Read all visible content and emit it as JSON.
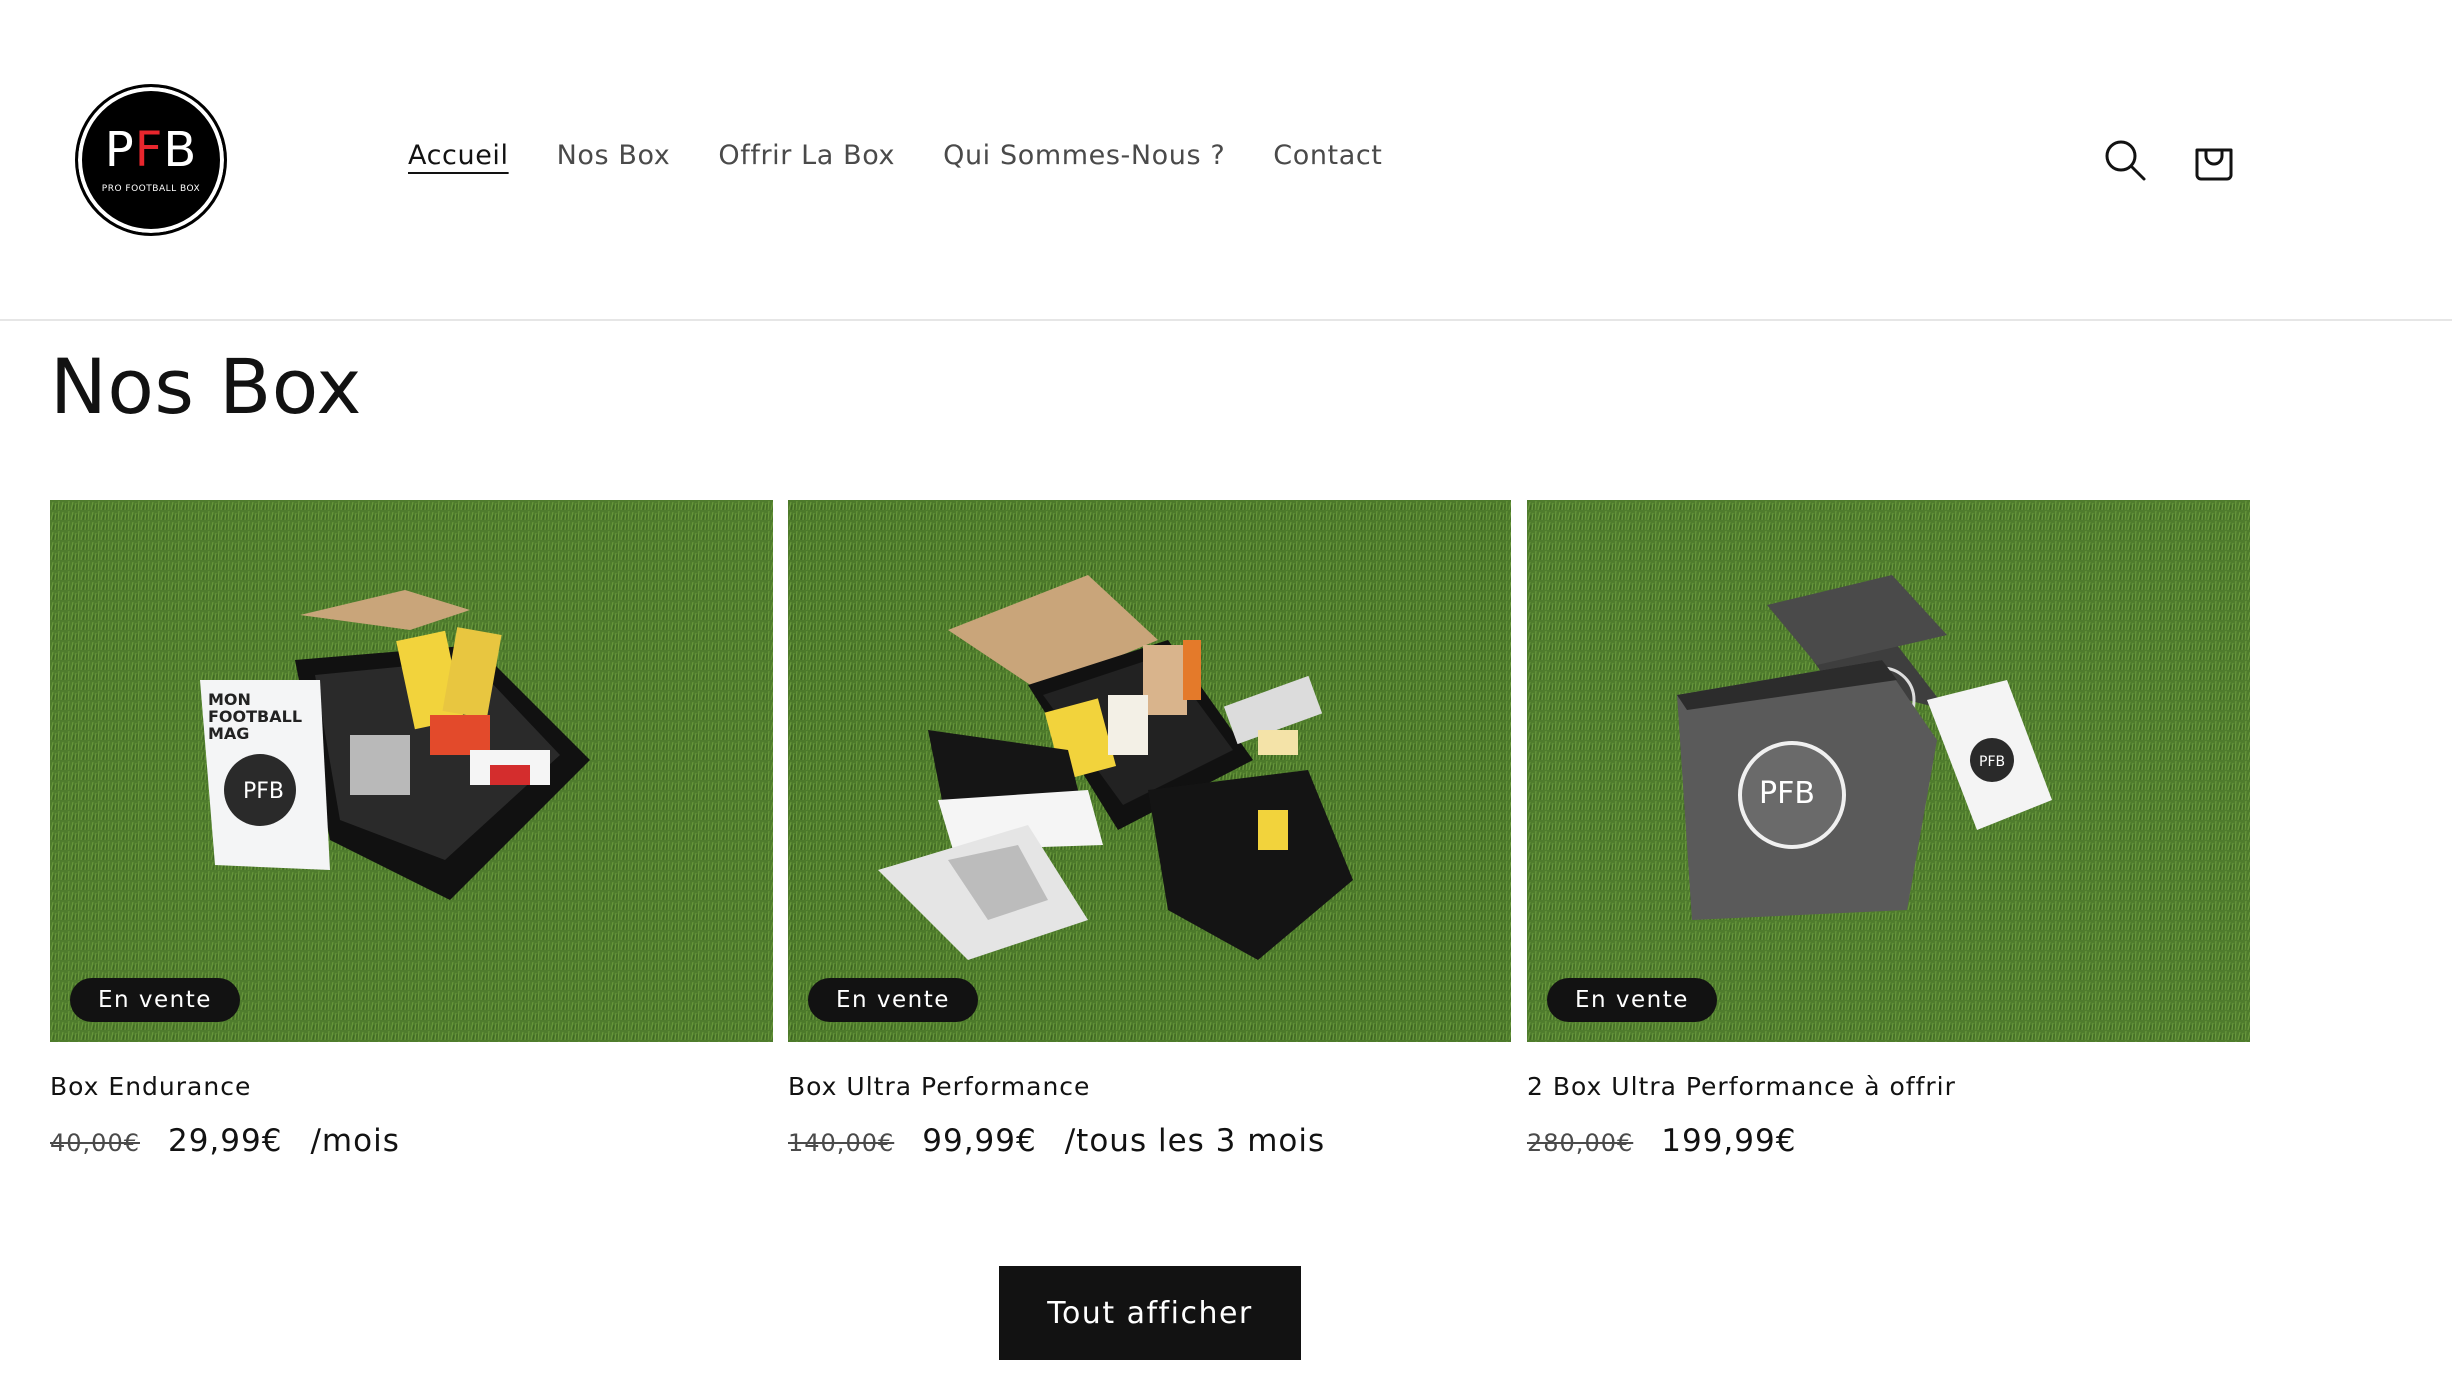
{
  "brand": {
    "letters_left": "P",
    "letters_mid": "F",
    "letters_right": "B",
    "tagline": "PRO FOOTBALL BOX",
    "accent": "#e8262d"
  },
  "nav": [
    {
      "label": "Accueil",
      "active": true
    },
    {
      "label": "Nos Box",
      "active": false
    },
    {
      "label": "Offrir La Box",
      "active": false
    },
    {
      "label": "Qui Sommes-Nous ?",
      "active": false
    },
    {
      "label": "Contact",
      "active": false
    }
  ],
  "icons": {
    "search": "search-icon",
    "cart": "cart-icon"
  },
  "page": {
    "title": "Nos Box"
  },
  "products": [
    {
      "name": "Box Endurance",
      "badge": "En vente",
      "price_old": "40,00€",
      "price_new": "29,99€",
      "unit": "/mois"
    },
    {
      "name": "Box Ultra Performance",
      "badge": "En vente",
      "price_old": "140,00€",
      "price_new": "99,99€",
      "unit": "/tous les 3 mois"
    },
    {
      "name": "2 Box Ultra Performance à offrir",
      "badge": "En vente",
      "price_old": "280,00€",
      "price_new": "199,99€",
      "unit": ""
    }
  ],
  "cta": {
    "label": "Tout afficher"
  },
  "colors": {
    "text": "#121212",
    "muted": "#4a4a4a",
    "grass": "#4e7a2c",
    "badge_bg": "#121212"
  }
}
